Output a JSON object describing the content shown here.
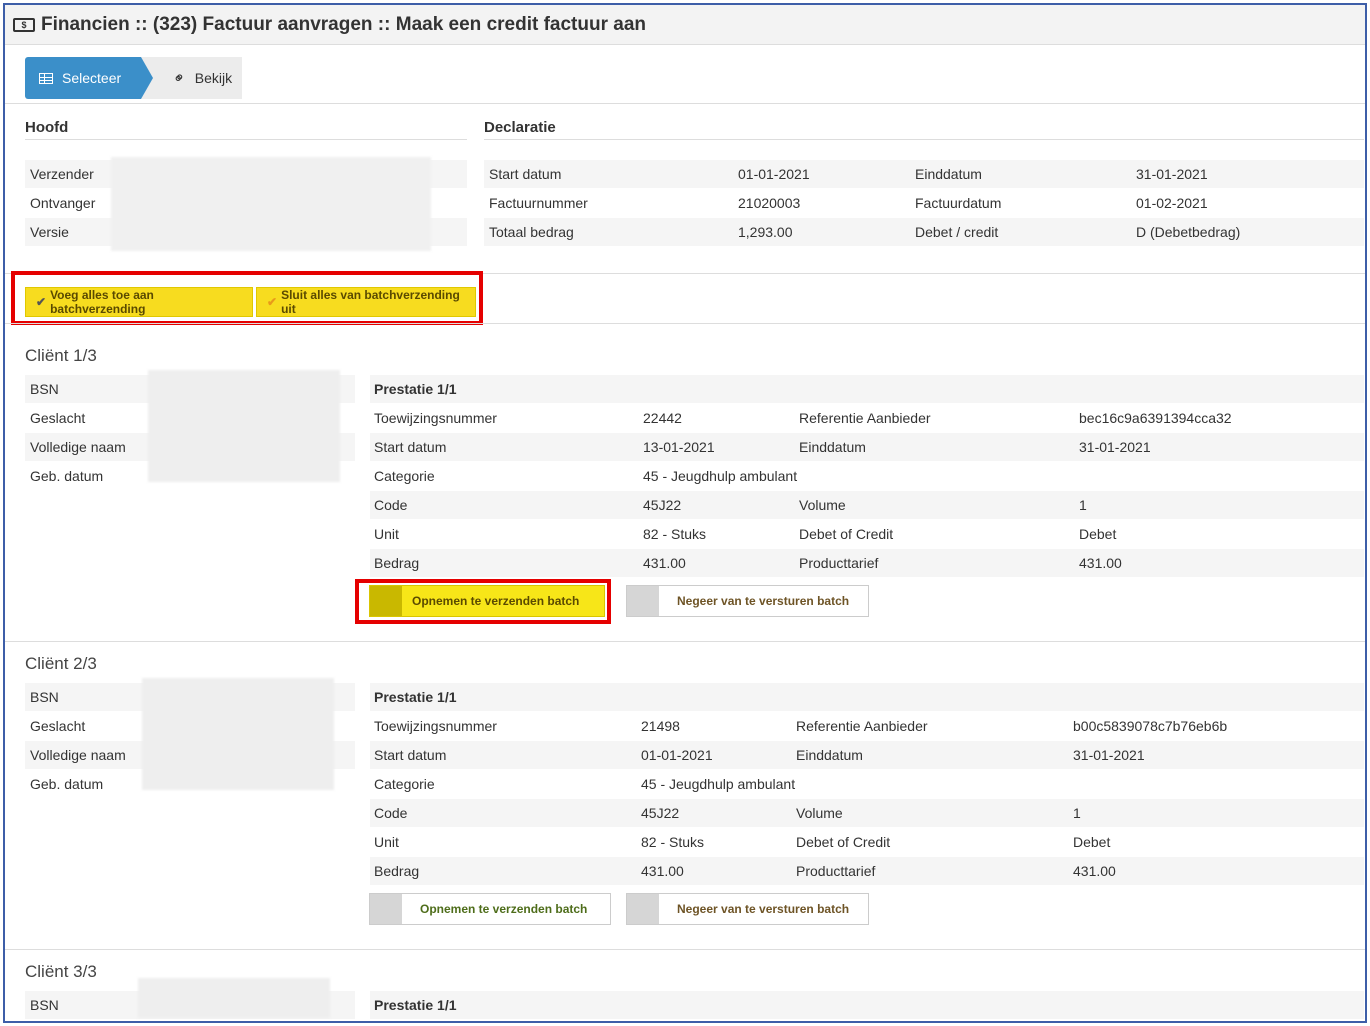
{
  "title": "Financien :: (323) Factuur aanvragen :: Maak een credit factuur aan",
  "title_icon": "money-icon",
  "wizard": {
    "steps": [
      {
        "label": "Selecteer",
        "icon": "table-icon",
        "active": true
      },
      {
        "label": "Bekijk",
        "icon": "link-icon",
        "active": false
      }
    ]
  },
  "hoofd": {
    "heading": "Hoofd",
    "rows": [
      {
        "label": "Verzender"
      },
      {
        "label": "Ontvanger"
      },
      {
        "label": "Versie"
      }
    ]
  },
  "declaratie": {
    "heading": "Declaratie",
    "rows": [
      {
        "l1": "Start datum",
        "v1": "01-01-2021",
        "l2": "Einddatum",
        "v2": "31-01-2021"
      },
      {
        "l1": "Factuurnummer",
        "v1": "21020003",
        "l2": "Factuurdatum",
        "v2": "01-02-2021"
      },
      {
        "l1": "Totaal bedrag",
        "v1": "1,293.00",
        "l2": "Debet / credit",
        "v2": "D (Debetbedrag)"
      }
    ]
  },
  "batch": {
    "add_all": "Voeg alles toe aan batchverzending",
    "exclude_all": "Sluit alles van batchverzending uit"
  },
  "client_fields": [
    "BSN",
    "Geslacht",
    "Volledige naam",
    "Geb. datum"
  ],
  "clients": [
    {
      "title": "Cliënt 1/3",
      "prestatie": "Prestatie 1/1",
      "toewijzingsnummer": "22442",
      "referentie": "bec16c9a6391394cca32",
      "start": "13-01-2021",
      "eind": "31-01-2021",
      "categorie": "45 - Jeugdhulp ambulant",
      "code": "45J22",
      "volume": "1",
      "unit": "82 - Stuks",
      "debet_credit": "Debet",
      "bedrag": "431.00",
      "producttarief": "431.00",
      "include_selected": true
    },
    {
      "title": "Cliënt 2/3",
      "prestatie": "Prestatie 1/1",
      "toewijzingsnummer": "21498",
      "referentie": "b00c5839078c7b76eb6b",
      "start": "01-01-2021",
      "eind": "31-01-2021",
      "categorie": "45 - Jeugdhulp ambulant",
      "code": "45J22",
      "volume": "1",
      "unit": "82 - Stuks",
      "debet_credit": "Debet",
      "bedrag": "431.00",
      "producttarief": "431.00",
      "include_selected": false
    },
    {
      "title": "Cliënt 3/3",
      "prestatie": "Prestatie 1/1"
    }
  ],
  "prestatie_labels": {
    "toewijzingsnummer": "Toewijzingsnummer",
    "referentie": "Referentie Aanbieder",
    "start": "Start datum",
    "eind": "Einddatum",
    "categorie": "Categorie",
    "code": "Code",
    "volume": "Volume",
    "unit": "Unit",
    "debet_credit": "Debet of Credit",
    "bedrag": "Bedrag",
    "producttarief": "Producttarief"
  },
  "buttons": {
    "include": "Opnemen te verzenden batch",
    "ignore": "Negeer van te versturen batch"
  },
  "colors": {
    "accent": "#3b8fc9",
    "highlight": "#f7dc1f",
    "annotation": "#e50000",
    "frame": "#3d5ea8"
  }
}
